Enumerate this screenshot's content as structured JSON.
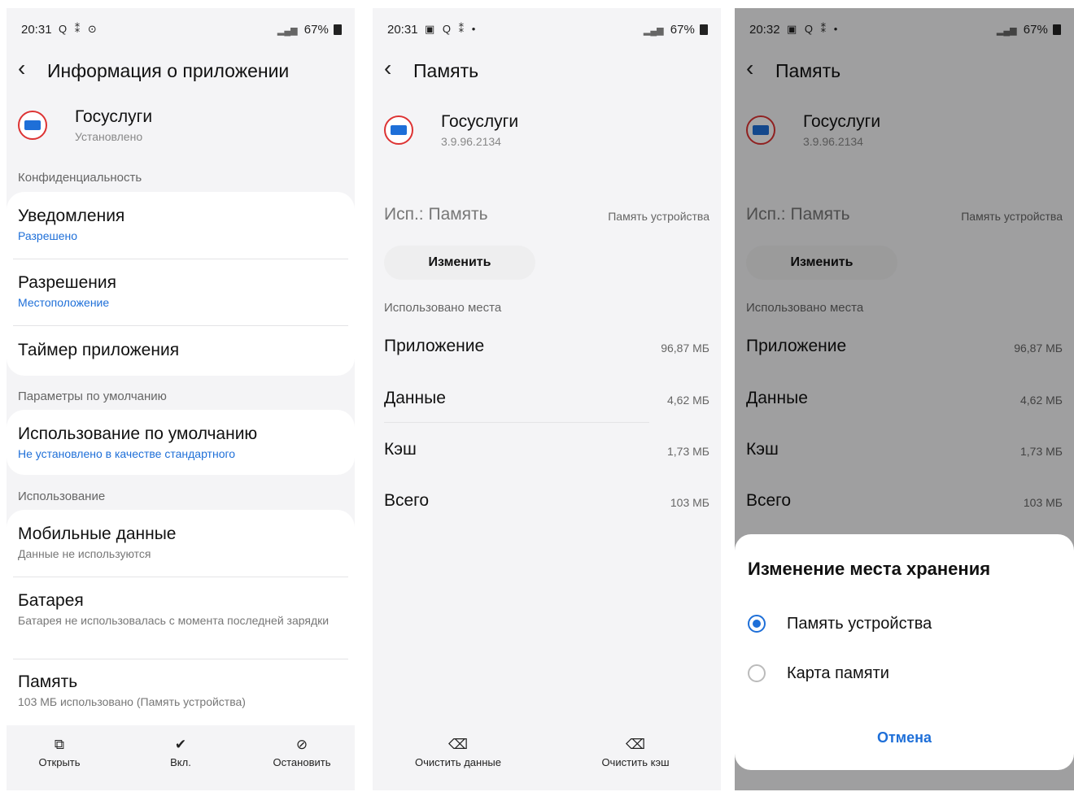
{
  "panel1": {
    "status": {
      "time": "20:31",
      "icons": "Q ⁑ ⊙",
      "battery": "67%"
    },
    "header": {
      "title": "Информация о приложении"
    },
    "app": {
      "name": "Госуслуги",
      "status": "Установлено"
    },
    "sections": {
      "privacy": "Конфиденциальность",
      "defaults": "Параметры по умолчанию",
      "usage": "Использование"
    },
    "items": {
      "notifications": {
        "title": "Уведомления",
        "sub": "Разрешено"
      },
      "permissions": {
        "title": "Разрешения",
        "sub": "Местоположение"
      },
      "timer": {
        "title": "Таймер приложения"
      },
      "default_use": {
        "title": "Использование по умолчанию",
        "sub": "Не установлено в качестве стандартного"
      },
      "mobile_data": {
        "title": "Мобильные данные",
        "sub": "Данные не используются"
      },
      "battery": {
        "title": "Батарея",
        "sub": "Батарея не использовалась с момента последней зарядки"
      },
      "memory": {
        "title": "Память",
        "sub": "103 МБ использовано (Память устройства)"
      }
    },
    "bottom": {
      "open": "Открыть",
      "enable": "Вкл.",
      "stop": "Остановить"
    }
  },
  "panel2": {
    "status": {
      "time": "20:31",
      "icons": "▣ Q ⁑ •",
      "battery": "67%"
    },
    "header": {
      "title": "Память"
    },
    "app": {
      "name": "Госуслуги",
      "version": "3.9.96.2134"
    },
    "storage_used": {
      "label": "Исп.: Память",
      "value": "Память устройства",
      "change_button": "Изменить"
    },
    "section": "Использовано места",
    "rows": [
      {
        "label": "Приложение",
        "value": "96,87 МБ"
      },
      {
        "label": "Данные",
        "value": "4,62 МБ"
      },
      {
        "label": "Кэш",
        "value": "1,73 МБ"
      },
      {
        "label": "Всего",
        "value": "103 МБ"
      }
    ],
    "bottom": {
      "clear_data": "Очистить данные",
      "clear_cache": "Очистить кэш"
    }
  },
  "panel3": {
    "status": {
      "time": "20:32",
      "icons": "▣ Q ⁑ •",
      "battery": "67%"
    },
    "header": {
      "title": "Память"
    },
    "app": {
      "name": "Госуслуги",
      "version": "3.9.96.2134"
    },
    "storage_used": {
      "label": "Исп.: Память",
      "value": "Память устройства",
      "change_button": "Изменить"
    },
    "section": "Использовано места",
    "rows": [
      {
        "label": "Приложение",
        "value": "96,87 МБ"
      },
      {
        "label": "Данные",
        "value": "4,62 МБ"
      },
      {
        "label": "Кэш",
        "value": "1,73 МБ"
      },
      {
        "label": "Всего",
        "value": "103 МБ"
      }
    ],
    "dialog": {
      "title": "Изменение места хранения",
      "options": [
        "Память устройства",
        "Карта памяти"
      ],
      "selected": "Память устройства",
      "cancel": "Отмена"
    }
  },
  "colors": {
    "accent": "#1e6fd8",
    "background": "#f4f4f6",
    "card": "#ffffff"
  },
  "icons": [
    "back-icon",
    "app-logo-icon",
    "open-icon",
    "enable-icon",
    "stop-icon",
    "clear-data-icon",
    "clear-cache-icon"
  ]
}
